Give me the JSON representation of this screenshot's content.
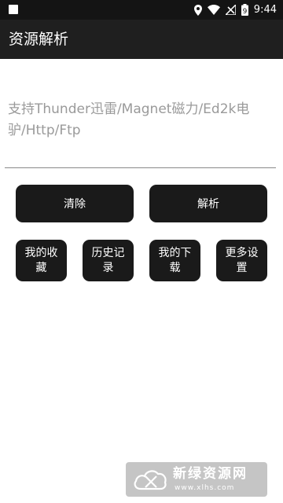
{
  "status_bar": {
    "time": "9:44",
    "battery_level": "9",
    "icons": [
      "notification-square-icon",
      "location-pin-icon",
      "wifi-icon",
      "no-signal-icon",
      "battery-icon"
    ]
  },
  "app_bar": {
    "title": "资源解析"
  },
  "resource_input": {
    "value": "",
    "placeholder": "支持Thunder迅雷/Magnet磁力/Ed2k电驴/Http/Ftp"
  },
  "actions": {
    "clear_label": "清除",
    "parse_label": "解析"
  },
  "shortcuts": {
    "favorites_label": "我的收藏",
    "history_label": "历史记录",
    "downloads_label": "我的下载",
    "settings_label": "更多设置"
  },
  "watermark": {
    "name": "新绿资源网",
    "url": "www.xlhs.com"
  },
  "colors": {
    "status_bar": "#141414",
    "app_bar": "#1f1f1f",
    "button": "#1a1a1a",
    "button_text": "#ffffff",
    "placeholder": "#9a9a9a"
  }
}
